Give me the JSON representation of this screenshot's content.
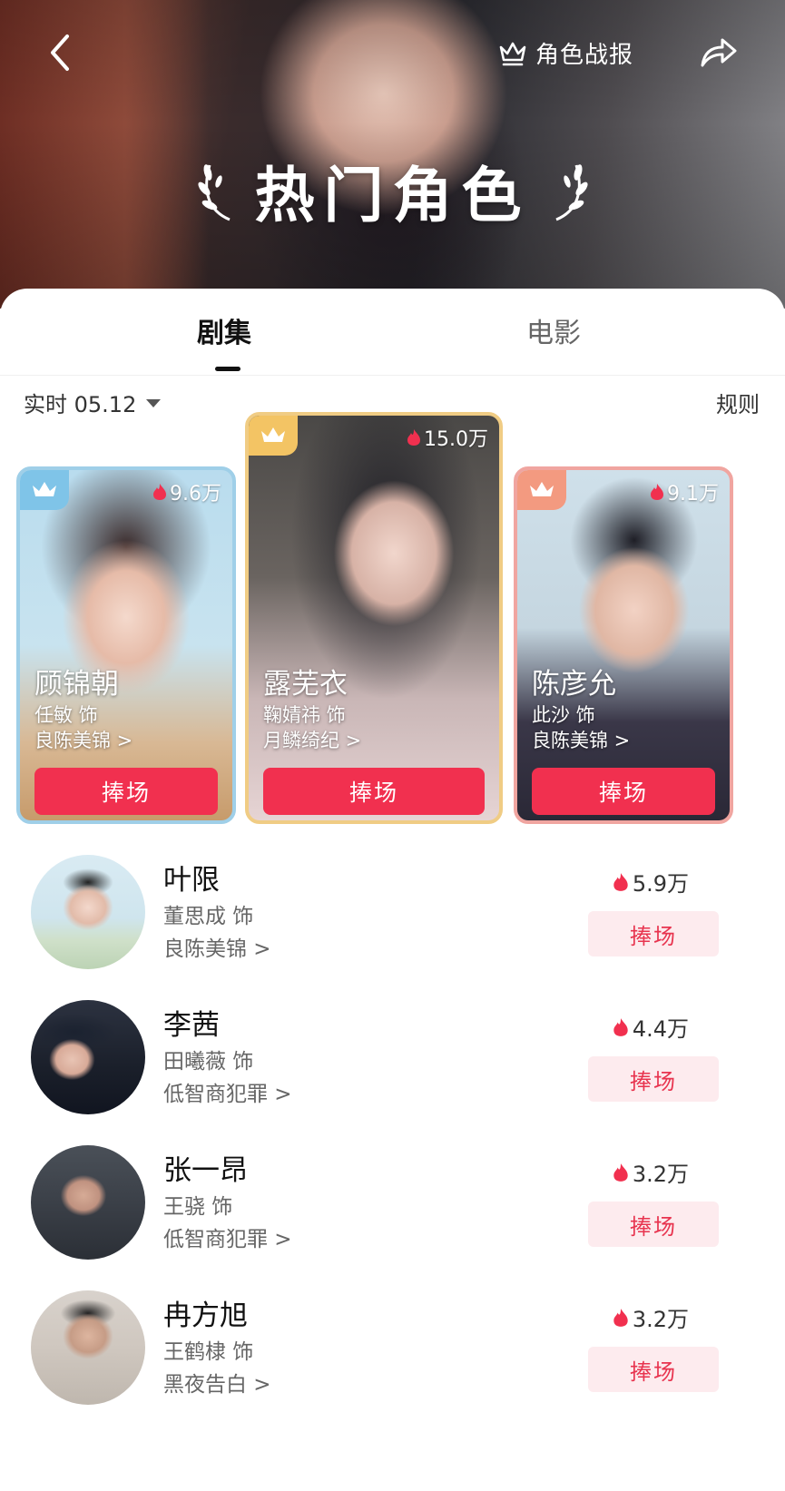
{
  "header": {
    "report_label": "角色战报",
    "title": "热门角色"
  },
  "tabs": [
    {
      "label": "剧集",
      "active": true
    },
    {
      "label": "电影",
      "active": false
    }
  ],
  "filter": {
    "label": "实时 05.12",
    "rules_label": "规则"
  },
  "top3": [
    {
      "rank": 2,
      "heat": "9.6万",
      "name": "顾锦朝",
      "actor": "任敏 饰",
      "drama": "良陈美锦 >",
      "button": "捧场",
      "accent": "#7fc4e8"
    },
    {
      "rank": 1,
      "heat": "15.0万",
      "name": "露芜衣",
      "actor": "鞠婧祎 饰",
      "drama": "月鳞绮纪 >",
      "button": "捧场",
      "accent": "#f3c464"
    },
    {
      "rank": 3,
      "heat": "9.1万",
      "name": "陈彦允",
      "actor": "此沙 饰",
      "drama": "良陈美锦 >",
      "button": "捧场",
      "accent": "#f39a80"
    }
  ],
  "list": [
    {
      "name": "叶限",
      "actor": "董思成 饰",
      "drama": "良陈美锦 >",
      "heat": "5.9万",
      "button": "捧场"
    },
    {
      "name": "李茜",
      "actor": "田曦薇 饰",
      "drama": "低智商犯罪 >",
      "heat": "4.4万",
      "button": "捧场"
    },
    {
      "name": "张一昂",
      "actor": "王骁 饰",
      "drama": "低智商犯罪 >",
      "heat": "3.2万",
      "button": "捧场"
    },
    {
      "name": "冉方旭",
      "actor": "王鹤棣 饰",
      "drama": "黑夜告白 >",
      "heat": "3.2万",
      "button": "捧场"
    }
  ],
  "colors": {
    "accent_red": "#f1304f",
    "button_light_bg": "#fdebee"
  }
}
